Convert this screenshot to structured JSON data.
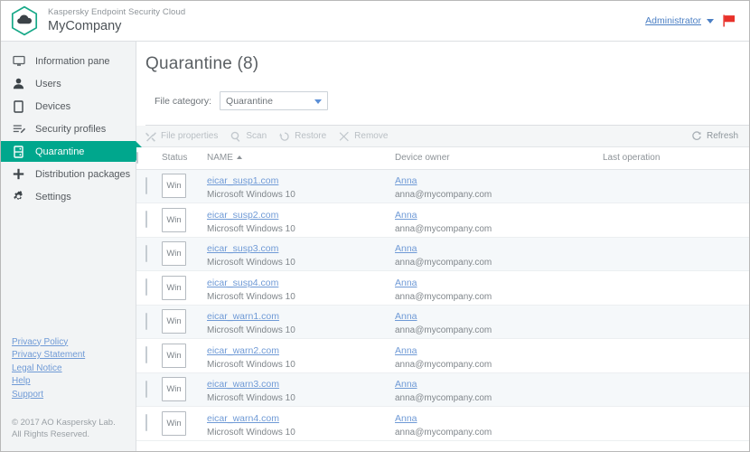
{
  "topbar": {
    "logo_icon": "hexagon-cloud-logo",
    "product_name": "Kaspersky Endpoint Security Cloud",
    "company_name": "MyCompany",
    "admin_label": "Administrator",
    "admin_chevron_icon": "chevron-down-icon",
    "flag_icon": "red-flag-icon",
    "accent_color": "#00a78d",
    "flag_color": "#e8312a",
    "link_color": "#4b7fc4"
  },
  "sidebar": {
    "items": [
      {
        "label": "Information pane",
        "icon": "monitor-icon",
        "active": false
      },
      {
        "label": "Users",
        "icon": "user-icon",
        "active": false
      },
      {
        "label": "Devices",
        "icon": "device-icon",
        "active": false
      },
      {
        "label": "Security profiles",
        "icon": "profile-list-icon",
        "active": false
      },
      {
        "label": "Quarantine",
        "icon": "quarantine-box-icon",
        "active": true
      },
      {
        "label": "Distribution packages",
        "icon": "plus-icon",
        "active": false
      },
      {
        "label": "Settings",
        "icon": "gear-icon",
        "active": false
      }
    ],
    "links": [
      "Privacy Policy",
      "Privacy Statement",
      "Legal Notice",
      "Help",
      "Support"
    ],
    "copyright": "© 2017 AO Kaspersky Lab. All Rights Reserved."
  },
  "main": {
    "page_title": "Quarantine (8)",
    "filter": {
      "label": "File category:",
      "selected": "Quarantine",
      "chevron_icon": "chevron-down-icon"
    },
    "toolbar": {
      "buttons": [
        {
          "label": "File properties",
          "icon": "tools-icon",
          "enabled": false
        },
        {
          "label": "Scan",
          "icon": "search-icon",
          "enabled": false
        },
        {
          "label": "Restore",
          "icon": "restore-icon",
          "enabled": false
        },
        {
          "label": "Remove",
          "icon": "close-icon",
          "enabled": false
        }
      ],
      "refresh": {
        "label": "Refresh",
        "icon": "refresh-icon",
        "enabled": true
      }
    },
    "table": {
      "columns": [
        {
          "key": "checkbox",
          "label": ""
        },
        {
          "key": "status",
          "label": "Status"
        },
        {
          "key": "name",
          "label": "NAME",
          "sorted": "asc"
        },
        {
          "key": "owner",
          "label": "Device owner"
        },
        {
          "key": "last",
          "label": "Last operation"
        }
      ],
      "rows": [
        {
          "status": "Win",
          "name": "eicar_susp1.com",
          "os": "Microsoft Windows 10",
          "owner": "Anna",
          "email": "anna@mycompany.com",
          "last": ""
        },
        {
          "status": "Win",
          "name": "eicar_susp2.com",
          "os": "Microsoft Windows 10",
          "owner": "Anna",
          "email": "anna@mycompany.com",
          "last": ""
        },
        {
          "status": "Win",
          "name": "eicar_susp3.com",
          "os": "Microsoft Windows 10",
          "owner": "Anna",
          "email": "anna@mycompany.com",
          "last": ""
        },
        {
          "status": "Win",
          "name": "eicar_susp4.com",
          "os": "Microsoft Windows 10",
          "owner": "Anna",
          "email": "anna@mycompany.com",
          "last": ""
        },
        {
          "status": "Win",
          "name": "eicar_warn1.com",
          "os": "Microsoft Windows 10",
          "owner": "Anna",
          "email": "anna@mycompany.com",
          "last": ""
        },
        {
          "status": "Win",
          "name": "eicar_warn2.com",
          "os": "Microsoft Windows 10",
          "owner": "Anna",
          "email": "anna@mycompany.com",
          "last": ""
        },
        {
          "status": "Win",
          "name": "eicar_warn3.com",
          "os": "Microsoft Windows 10",
          "owner": "Anna",
          "email": "anna@mycompany.com",
          "last": ""
        },
        {
          "status": "Win",
          "name": "eicar_warn4.com",
          "os": "Microsoft Windows 10",
          "owner": "Anna",
          "email": "anna@mycompany.com",
          "last": ""
        }
      ]
    }
  }
}
